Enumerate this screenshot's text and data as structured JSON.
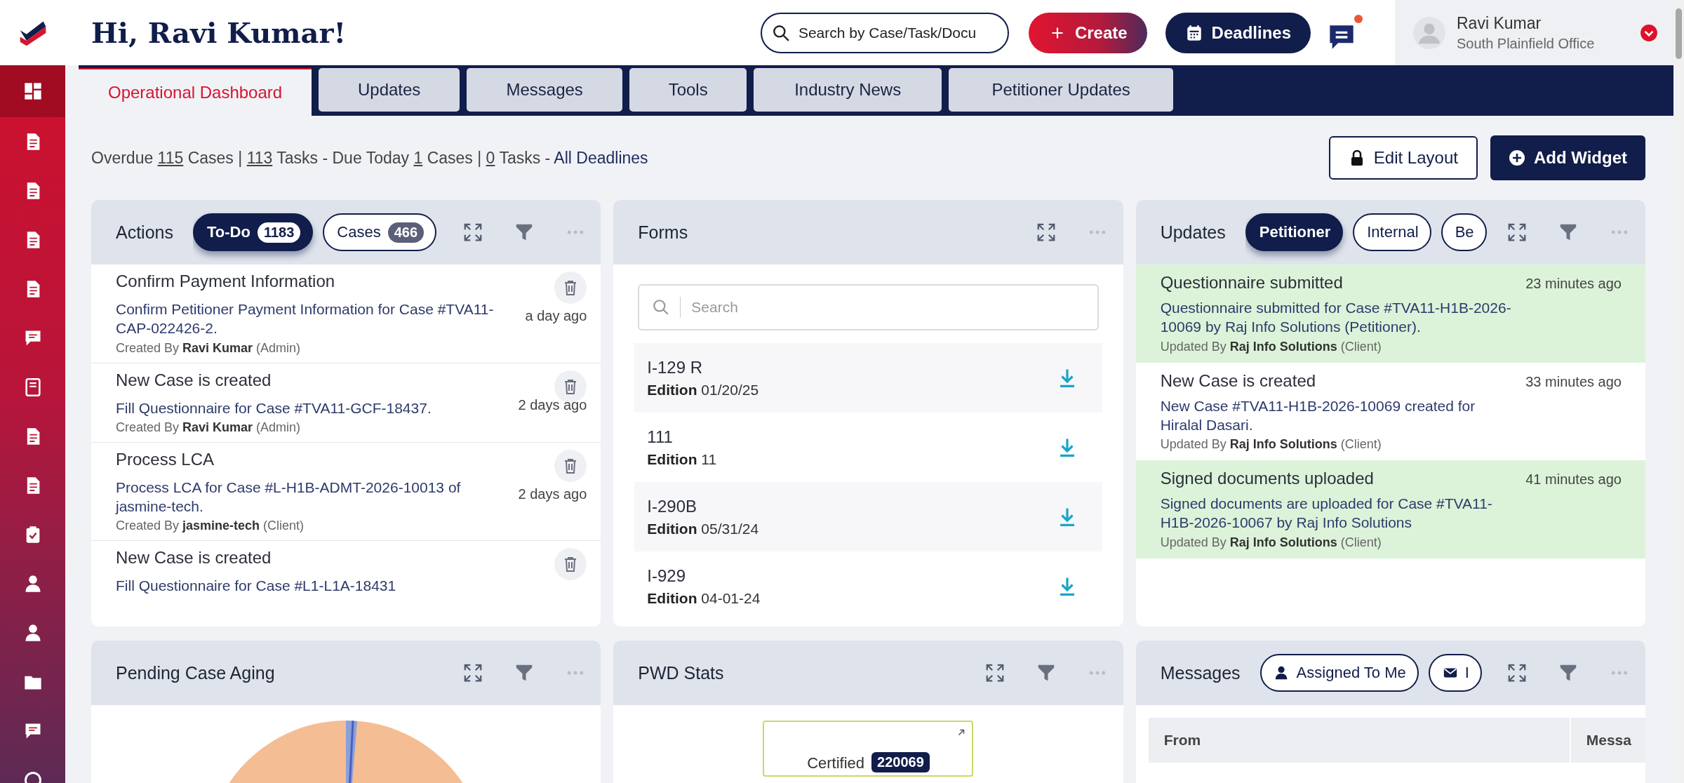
{
  "header": {
    "greeting": "Hi, Ravi Kumar!",
    "search": {
      "placeholder": "Search by Case/Task/Docu"
    },
    "create_button": "Create",
    "deadlines_button": "Deadlines",
    "chat": {
      "unread": true
    },
    "user": {
      "name": "Ravi Kumar",
      "office": "South Plainfield Office"
    }
  },
  "sidebar": {
    "items": [
      {
        "selected": true
      },
      {
        "selected": false
      },
      {
        "selected": false
      },
      {
        "selected": false
      },
      {
        "selected": false
      },
      {
        "selected": false
      },
      {
        "selected": false
      },
      {
        "selected": false
      },
      {
        "selected": false
      },
      {
        "selected": false
      },
      {
        "selected": false
      },
      {
        "selected": false
      },
      {
        "selected": false
      },
      {
        "selected": false
      },
      {
        "selected": false
      }
    ]
  },
  "tabs": [
    {
      "label": "Operational Dashboard",
      "selected": true
    },
    {
      "label": "Updates",
      "selected": false
    },
    {
      "label": "Messages",
      "selected": false
    },
    {
      "label": "Tools",
      "selected": false
    },
    {
      "label": "Industry News",
      "selected": false
    },
    {
      "label": "Petitioner Updates",
      "selected": false
    }
  ],
  "summary": {
    "segments": [
      {
        "kind": "text",
        "text": "Overdue"
      },
      {
        "kind": "link",
        "text": "115"
      },
      {
        "kind": "text",
        "text": "Cases |"
      },
      {
        "kind": "link",
        "text": "113"
      },
      {
        "kind": "text",
        "text": "Tasks - Due Today"
      },
      {
        "kind": "link",
        "text": "1"
      },
      {
        "kind": "text",
        "text": "Cases |"
      },
      {
        "kind": "link",
        "text": "0"
      },
      {
        "kind": "text",
        "text": "Tasks -"
      },
      {
        "kind": "cta",
        "text": "All Deadlines"
      }
    ]
  },
  "toolbar": {
    "edit_layout": "Edit Layout",
    "add_widget": "Add Widget"
  },
  "actions": {
    "title": "Actions",
    "tabs": [
      {
        "label": "To-Do",
        "count": "1183",
        "selected": true
      },
      {
        "label": "Cases",
        "count": "466",
        "selected": false
      }
    ],
    "items": [
      {
        "title": "Confirm Payment Information",
        "description": "Confirm Petitioner Payment Information for Case #TVA11-CAP-022426-2.",
        "meta": "Created By **Ravi Kumar** (Admin)",
        "time": "a day ago"
      },
      {
        "title": "New Case is created",
        "description": "Fill Questionnaire for Case #TVA11-GCF-18437.",
        "meta": "Created By **Ravi Kumar** (Admin)",
        "time": "2 days ago"
      },
      {
        "title": "Process LCA",
        "description": "Process LCA for Case #L-H1B-ADMT-2026-10013 of jasmine-tech.",
        "meta": "Created By **jasmine-tech** (Client)",
        "time": "2 days ago"
      },
      {
        "title": "New Case is created",
        "description": "Fill Questionnaire for Case #L1-L1A-18431"
      }
    ]
  },
  "forms": {
    "title": "Forms",
    "search": {
      "placeholder": "Search"
    },
    "items": [
      {
        "name": "I-129 R",
        "edition_label": "Edition",
        "edition": "01/20/25"
      },
      {
        "name": "111",
        "edition_label": "Edition",
        "edition": "11"
      },
      {
        "name": "I-290B",
        "edition_label": "Edition",
        "edition": "05/31/24"
      },
      {
        "name": "I-929",
        "edition_label": "Edition",
        "edition": "04-01-24"
      }
    ]
  },
  "updates": {
    "title": "Updates",
    "tabs": [
      {
        "label": "Petitioner",
        "selected": true
      },
      {
        "label": "Internal",
        "selected": false
      },
      {
        "label": "Be",
        "selected": false
      }
    ],
    "items": [
      {
        "title": "Questionnaire submitted",
        "description": "Questionnaire submitted for Case #TVA11-H1B-2026-10069 by Raj Info Solutions (Petitioner).",
        "meta": "Updated By **Raj Info Solutions** (Client)",
        "time": "23 minutes ago",
        "unread": true
      },
      {
        "title": "New Case is created",
        "description": "New Case #TVA11-H1B-2026-10069 created for Hiralal Dasari.",
        "meta": "Updated By **Raj Info Solutions** (Client)",
        "time": "33 minutes ago",
        "unread": false
      },
      {
        "title": "Signed documents uploaded",
        "description": "Signed documents are uploaded for Case #TVA11-H1B-2026-10067 by Raj Info Solutions",
        "meta": "Updated By **Raj Info Solutions** (Client)",
        "time": "41 minutes ago",
        "unread": true
      }
    ]
  },
  "pending_case_aging": {
    "title": "Pending Case Aging"
  },
  "pwd_stats": {
    "title": "PWD Stats",
    "stat": {
      "label": "Certified",
      "value": "220069"
    }
  },
  "messages": {
    "title": "Messages",
    "tabs": [
      {
        "label": "Assigned To Me",
        "selected": false
      },
      {
        "label": "I",
        "selected": false
      }
    ],
    "table": {
      "columns": [
        "From",
        "Messa"
      ]
    }
  }
}
